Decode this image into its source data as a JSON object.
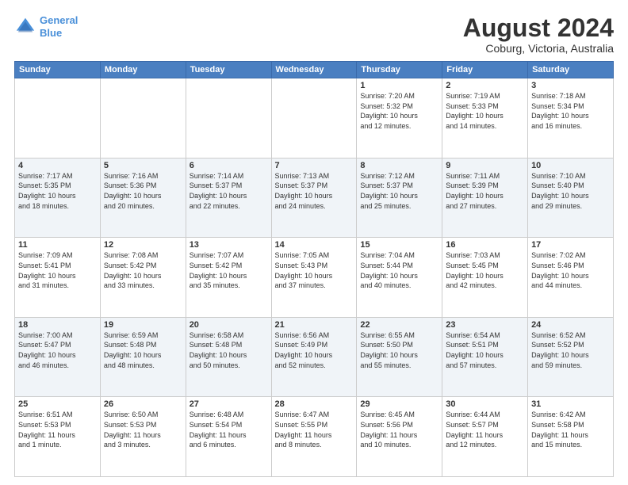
{
  "logo": {
    "line1": "General",
    "line2": "Blue"
  },
  "title": "August 2024",
  "subtitle": "Coburg, Victoria, Australia",
  "days_of_week": [
    "Sunday",
    "Monday",
    "Tuesday",
    "Wednesday",
    "Thursday",
    "Friday",
    "Saturday"
  ],
  "weeks": [
    {
      "alt": false,
      "days": [
        {
          "num": "",
          "info": ""
        },
        {
          "num": "",
          "info": ""
        },
        {
          "num": "",
          "info": ""
        },
        {
          "num": "",
          "info": ""
        },
        {
          "num": "1",
          "info": "Sunrise: 7:20 AM\nSunset: 5:32 PM\nDaylight: 10 hours\nand 12 minutes."
        },
        {
          "num": "2",
          "info": "Sunrise: 7:19 AM\nSunset: 5:33 PM\nDaylight: 10 hours\nand 14 minutes."
        },
        {
          "num": "3",
          "info": "Sunrise: 7:18 AM\nSunset: 5:34 PM\nDaylight: 10 hours\nand 16 minutes."
        }
      ]
    },
    {
      "alt": true,
      "days": [
        {
          "num": "4",
          "info": "Sunrise: 7:17 AM\nSunset: 5:35 PM\nDaylight: 10 hours\nand 18 minutes."
        },
        {
          "num": "5",
          "info": "Sunrise: 7:16 AM\nSunset: 5:36 PM\nDaylight: 10 hours\nand 20 minutes."
        },
        {
          "num": "6",
          "info": "Sunrise: 7:14 AM\nSunset: 5:37 PM\nDaylight: 10 hours\nand 22 minutes."
        },
        {
          "num": "7",
          "info": "Sunrise: 7:13 AM\nSunset: 5:37 PM\nDaylight: 10 hours\nand 24 minutes."
        },
        {
          "num": "8",
          "info": "Sunrise: 7:12 AM\nSunset: 5:37 PM\nDaylight: 10 hours\nand 25 minutes."
        },
        {
          "num": "9",
          "info": "Sunrise: 7:11 AM\nSunset: 5:39 PM\nDaylight: 10 hours\nand 27 minutes."
        },
        {
          "num": "10",
          "info": "Sunrise: 7:10 AM\nSunset: 5:40 PM\nDaylight: 10 hours\nand 29 minutes."
        }
      ]
    },
    {
      "alt": false,
      "days": [
        {
          "num": "11",
          "info": "Sunrise: 7:09 AM\nSunset: 5:41 PM\nDaylight: 10 hours\nand 31 minutes."
        },
        {
          "num": "12",
          "info": "Sunrise: 7:08 AM\nSunset: 5:42 PM\nDaylight: 10 hours\nand 33 minutes."
        },
        {
          "num": "13",
          "info": "Sunrise: 7:07 AM\nSunset: 5:42 PM\nDaylight: 10 hours\nand 35 minutes."
        },
        {
          "num": "14",
          "info": "Sunrise: 7:05 AM\nSunset: 5:43 PM\nDaylight: 10 hours\nand 37 minutes."
        },
        {
          "num": "15",
          "info": "Sunrise: 7:04 AM\nSunset: 5:44 PM\nDaylight: 10 hours\nand 40 minutes."
        },
        {
          "num": "16",
          "info": "Sunrise: 7:03 AM\nSunset: 5:45 PM\nDaylight: 10 hours\nand 42 minutes."
        },
        {
          "num": "17",
          "info": "Sunrise: 7:02 AM\nSunset: 5:46 PM\nDaylight: 10 hours\nand 44 minutes."
        }
      ]
    },
    {
      "alt": true,
      "days": [
        {
          "num": "18",
          "info": "Sunrise: 7:00 AM\nSunset: 5:47 PM\nDaylight: 10 hours\nand 46 minutes."
        },
        {
          "num": "19",
          "info": "Sunrise: 6:59 AM\nSunset: 5:48 PM\nDaylight: 10 hours\nand 48 minutes."
        },
        {
          "num": "20",
          "info": "Sunrise: 6:58 AM\nSunset: 5:48 PM\nDaylight: 10 hours\nand 50 minutes."
        },
        {
          "num": "21",
          "info": "Sunrise: 6:56 AM\nSunset: 5:49 PM\nDaylight: 10 hours\nand 52 minutes."
        },
        {
          "num": "22",
          "info": "Sunrise: 6:55 AM\nSunset: 5:50 PM\nDaylight: 10 hours\nand 55 minutes."
        },
        {
          "num": "23",
          "info": "Sunrise: 6:54 AM\nSunset: 5:51 PM\nDaylight: 10 hours\nand 57 minutes."
        },
        {
          "num": "24",
          "info": "Sunrise: 6:52 AM\nSunset: 5:52 PM\nDaylight: 10 hours\nand 59 minutes."
        }
      ]
    },
    {
      "alt": false,
      "days": [
        {
          "num": "25",
          "info": "Sunrise: 6:51 AM\nSunset: 5:53 PM\nDaylight: 11 hours\nand 1 minute."
        },
        {
          "num": "26",
          "info": "Sunrise: 6:50 AM\nSunset: 5:53 PM\nDaylight: 11 hours\nand 3 minutes."
        },
        {
          "num": "27",
          "info": "Sunrise: 6:48 AM\nSunset: 5:54 PM\nDaylight: 11 hours\nand 6 minutes."
        },
        {
          "num": "28",
          "info": "Sunrise: 6:47 AM\nSunset: 5:55 PM\nDaylight: 11 hours\nand 8 minutes."
        },
        {
          "num": "29",
          "info": "Sunrise: 6:45 AM\nSunset: 5:56 PM\nDaylight: 11 hours\nand 10 minutes."
        },
        {
          "num": "30",
          "info": "Sunrise: 6:44 AM\nSunset: 5:57 PM\nDaylight: 11 hours\nand 12 minutes."
        },
        {
          "num": "31",
          "info": "Sunrise: 6:42 AM\nSunset: 5:58 PM\nDaylight: 11 hours\nand 15 minutes."
        }
      ]
    }
  ]
}
